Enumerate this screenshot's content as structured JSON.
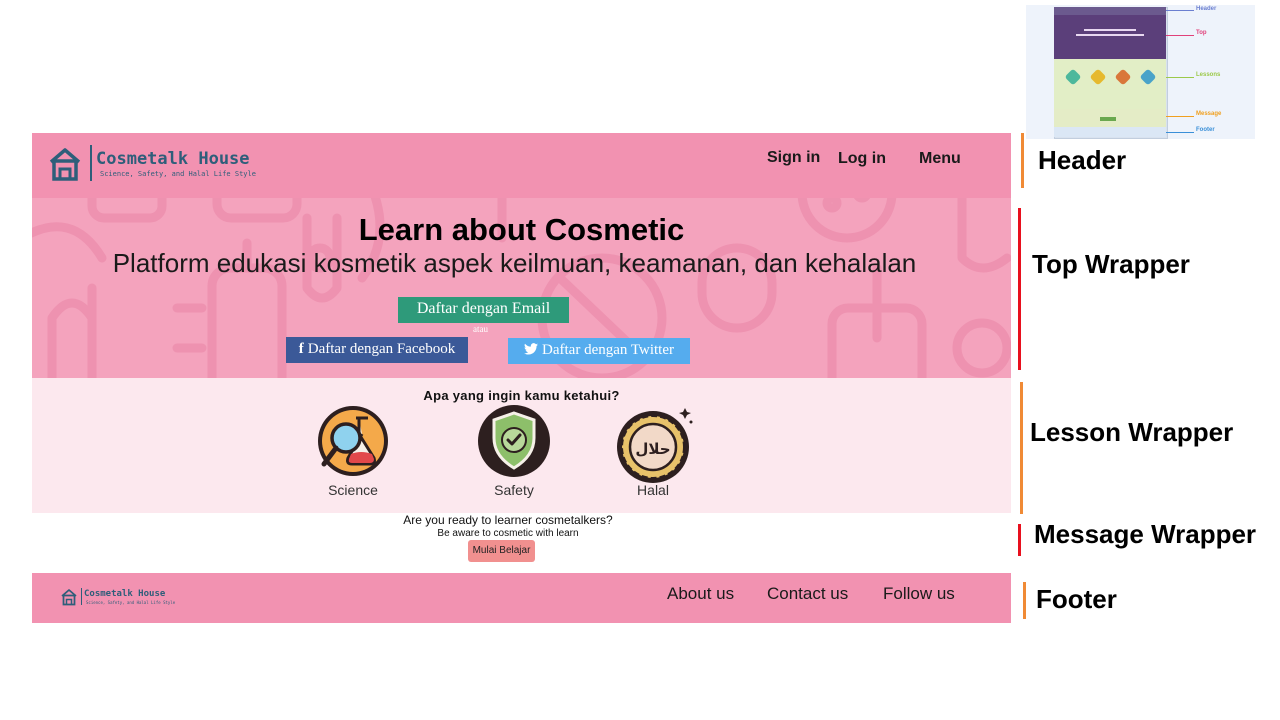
{
  "thumbnail": {
    "labels": {
      "header": "Header",
      "top": "Top",
      "lessons": "Lessons",
      "message": "Message",
      "footer": "Footer"
    },
    "colors": {
      "header": "#6b7fd0",
      "top": "#e0417a",
      "lessons": "#9cc94a",
      "message": "#f0a020",
      "footer": "#3a8fd8"
    }
  },
  "header": {
    "brand_title": "Cosmetalk House",
    "brand_tagline": "Science, Safety, and Halal Life Style",
    "nav": {
      "signin": "Sign in",
      "login": "Log in",
      "menu": "Menu"
    }
  },
  "top": {
    "title": "Learn about Cosmetic",
    "subtitle": "Platform edukasi kosmetik aspek keilmuan, keamanan, dan kehalalan",
    "email_button": "Daftar dengan Email",
    "separator": "atau",
    "facebook_icon": "f",
    "facebook_button": "Daftar dengan Facebook",
    "twitter_button": "Daftar dengan Twitter"
  },
  "lesson": {
    "question": "Apa yang ingin kamu ketahui?",
    "topics": [
      {
        "label": "Science",
        "icon": "science-icon"
      },
      {
        "label": "Safety",
        "icon": "safety-shield-icon"
      },
      {
        "label": "Halal",
        "icon": "halal-badge-icon"
      }
    ],
    "halal_text": "حلال"
  },
  "message": {
    "question": "Are you ready to learner cosmetalkers?",
    "sub": "Be aware to cosmetic with learn",
    "button": "Mulai Belajar"
  },
  "footer": {
    "brand_title": "Cosmetalk House",
    "brand_tagline": "Science, Safety, and Halal Life Style",
    "links": {
      "about": "About us",
      "contact": "Contact us",
      "follow": "Follow us"
    }
  },
  "annotations": {
    "header": "Header",
    "top": "Top Wrapper",
    "lesson": "Lesson Wrapper",
    "message": "Message Wrapper",
    "footer": "Footer",
    "colors": {
      "header": "#f08a35",
      "top": "#e8101e",
      "lesson": "#f08a35",
      "message": "#e8101e",
      "footer": "#f08a35"
    }
  },
  "palette": {
    "pink": "#f292b1",
    "pink_light": "#fce8ee",
    "brand_blue": "#2e5e7a",
    "email_green": "#2e9a7a",
    "facebook": "#3b5998",
    "twitter": "#55acee",
    "start_button": "#f1908f"
  }
}
